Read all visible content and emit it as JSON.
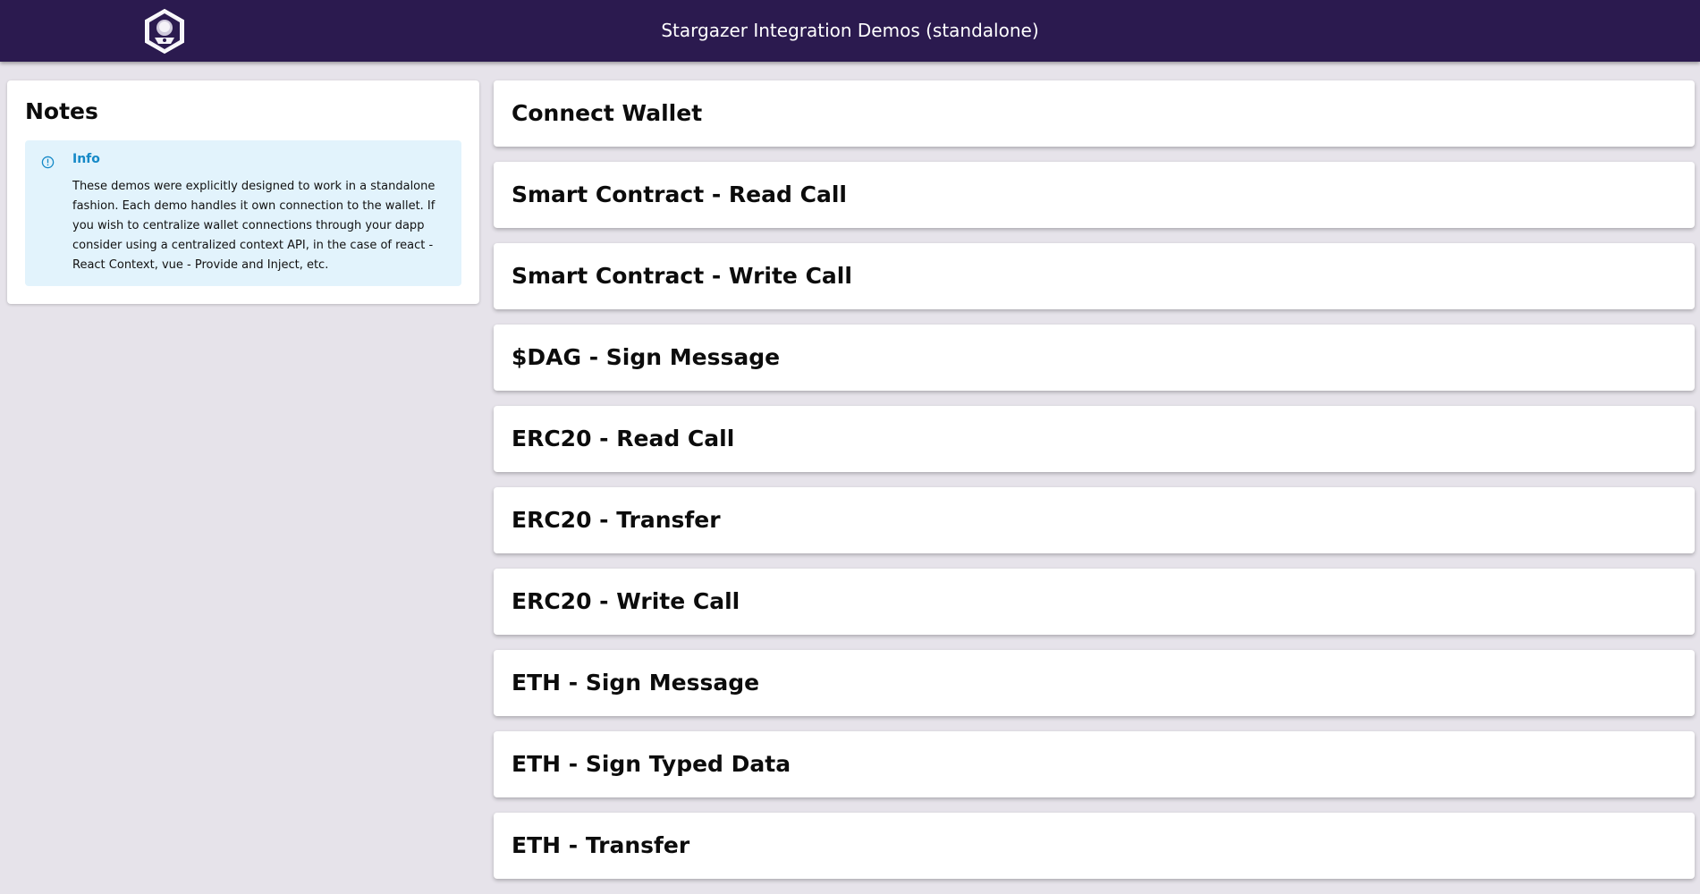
{
  "header": {
    "title": "Stargazer Integration Demos (standalone)",
    "logo_icon": "stargazer-logo-icon"
  },
  "notes": {
    "title": "Notes",
    "info": {
      "icon": "info-icon",
      "title": "Info",
      "text": "These demos were explicitly designed to work in a standalone fashion. Each demo handles it own connection to the wallet. If you wish to centralize wallet connections through your dapp consider using a centralized context API, in the case of react - React Context, vue - Provide and Inject, etc.",
      "accent_color": "#1589c7",
      "background_color": "#e2f3fc"
    }
  },
  "demos": [
    {
      "label": "Connect Wallet"
    },
    {
      "label": "Smart Contract - Read Call"
    },
    {
      "label": "Smart Contract - Write Call"
    },
    {
      "label": "$DAG - Sign Message"
    },
    {
      "label": "ERC20 - Read Call"
    },
    {
      "label": "ERC20 - Transfer"
    },
    {
      "label": "ERC20 - Write Call"
    },
    {
      "label": "ETH - Sign Message"
    },
    {
      "label": "ETH - Sign Typed Data"
    },
    {
      "label": "ETH - Transfer"
    }
  ],
  "colors": {
    "header_background": "#2b1a4f",
    "page_background": "#e6e3ea"
  }
}
